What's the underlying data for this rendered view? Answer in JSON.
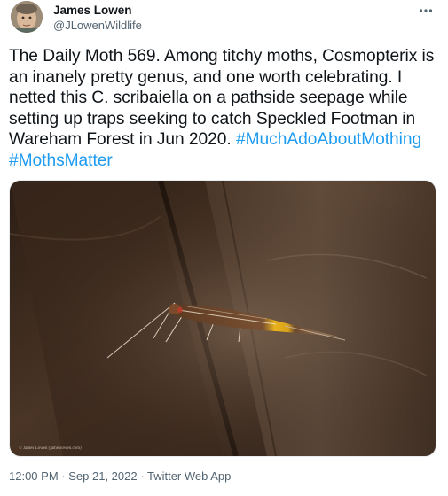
{
  "author": {
    "name": "James Lowen",
    "handle": "@JLowenWildlife"
  },
  "tweet": {
    "text_before": "The Daily Moth 569. Among titchy moths, Cosmopterix is an inanely pretty genus, and one worth celebrating. I netted this C. scribaiella on a pathside seepage while setting up traps seeking to catch Speckled Footman in Wareham Forest in Jun 2020. ",
    "hashtags": [
      "#MuchAdoAboutMothing",
      "#MothsMatter"
    ]
  },
  "media": {
    "photo_credit": "© James Lowen (jameslowen.com)"
  },
  "meta": {
    "time": "12:00 PM",
    "separator": "·",
    "date": "Sep 21, 2022",
    "source": "Twitter Web App"
  },
  "icons": {
    "more": "more-horizontal-icon"
  }
}
